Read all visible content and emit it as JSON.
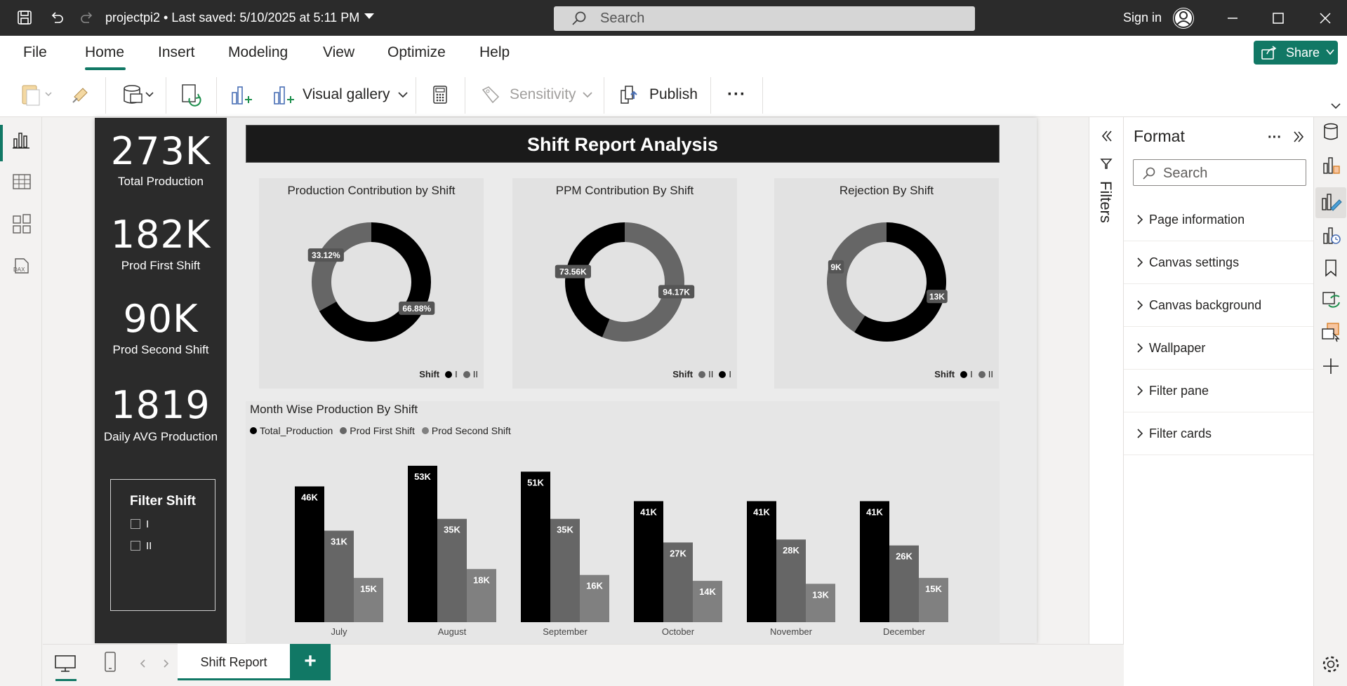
{
  "titlebar": {
    "title": "projectpi2 • Last saved: 5/10/2025 at 5:11 PM",
    "search_placeholder": "Search",
    "sign_in": "Sign in"
  },
  "ribbon": {
    "menu": [
      "File",
      "Home",
      "Insert",
      "Modeling",
      "View",
      "Optimize",
      "Help"
    ],
    "active_menu": "Home",
    "share_label": "Share",
    "visual_gallery_label": "Visual gallery",
    "sensitivity_label": "Sensitivity",
    "publish_label": "Publish",
    "more_label": "···"
  },
  "report": {
    "title": "Shift Report Analysis",
    "kpis": [
      {
        "value": "273K",
        "label": "Total Production"
      },
      {
        "value": "182K",
        "label": "Prod First Shift"
      },
      {
        "value": "90K",
        "label": "Prod Second Shift"
      },
      {
        "value": "1819",
        "label": "Daily AVG Production"
      }
    ],
    "slicer": {
      "title": "Filter Shift",
      "options": [
        "I",
        "II"
      ]
    },
    "donuts": [
      {
        "title": "Production Contribution by Shift",
        "legend_title": "Shift",
        "slices": [
          {
            "name": "I",
            "value": 66.88,
            "label": "66.88%",
            "color": "#000000"
          },
          {
            "name": "II",
            "value": 33.12,
            "label": "33.12%",
            "color": "#666666"
          }
        ],
        "legend": [
          {
            "name": "I",
            "color": "#000000"
          },
          {
            "name": "II",
            "color": "#666666"
          }
        ]
      },
      {
        "title": "PPM Contribution By Shift",
        "legend_title": "Shift",
        "slices": [
          {
            "name": "II",
            "value": 94.17,
            "label": "94.17K",
            "color": "#666666"
          },
          {
            "name": "I",
            "value": 73.56,
            "label": "73.56K",
            "color": "#000000"
          }
        ],
        "legend": [
          {
            "name": "II",
            "color": "#666666"
          },
          {
            "name": "I",
            "color": "#000000"
          }
        ]
      },
      {
        "title": "Rejection By Shift",
        "legend_title": "Shift",
        "slices": [
          {
            "name": "I",
            "value": 13,
            "label": "13K",
            "color": "#000000"
          },
          {
            "name": "II",
            "value": 9,
            "label": "9K",
            "color": "#666666"
          }
        ],
        "legend": [
          {
            "name": "I",
            "color": "#000000"
          },
          {
            "name": "II",
            "color": "#666666"
          }
        ]
      }
    ]
  },
  "chart_data": {
    "type": "bar",
    "title": "Month Wise Production By Shift",
    "categories": [
      "July",
      "August",
      "September",
      "October",
      "November",
      "December"
    ],
    "series": [
      {
        "name": "Total_Production",
        "color": "#000000",
        "values": [
          46,
          53,
          51,
          41,
          41,
          41
        ],
        "labels": [
          "46K",
          "53K",
          "51K",
          "41K",
          "41K",
          "41K"
        ]
      },
      {
        "name": "Prod First Shift",
        "color": "#666666",
        "values": [
          31,
          35,
          35,
          27,
          28,
          26
        ],
        "labels": [
          "31K",
          "35K",
          "35K",
          "27K",
          "28K",
          "26K"
        ]
      },
      {
        "name": "Prod Second Shift",
        "color": "#808080",
        "values": [
          15,
          18,
          16,
          14,
          13,
          15
        ],
        "labels": [
          "15K",
          "18K",
          "16K",
          "14K",
          "13K",
          "15K"
        ]
      }
    ],
    "ylim": [
      0,
      53
    ]
  },
  "filters_pane": {
    "label": "Filters"
  },
  "format_pane": {
    "title": "Format",
    "search_placeholder": "Search",
    "sections": [
      "Page information",
      "Canvas settings",
      "Canvas background",
      "Wallpaper",
      "Filter pane",
      "Filter cards"
    ]
  },
  "pages": {
    "active": "Shift Report",
    "add_label": "+"
  },
  "colors": {
    "accent": "#117865",
    "titlebar": "#2b2b2b"
  }
}
